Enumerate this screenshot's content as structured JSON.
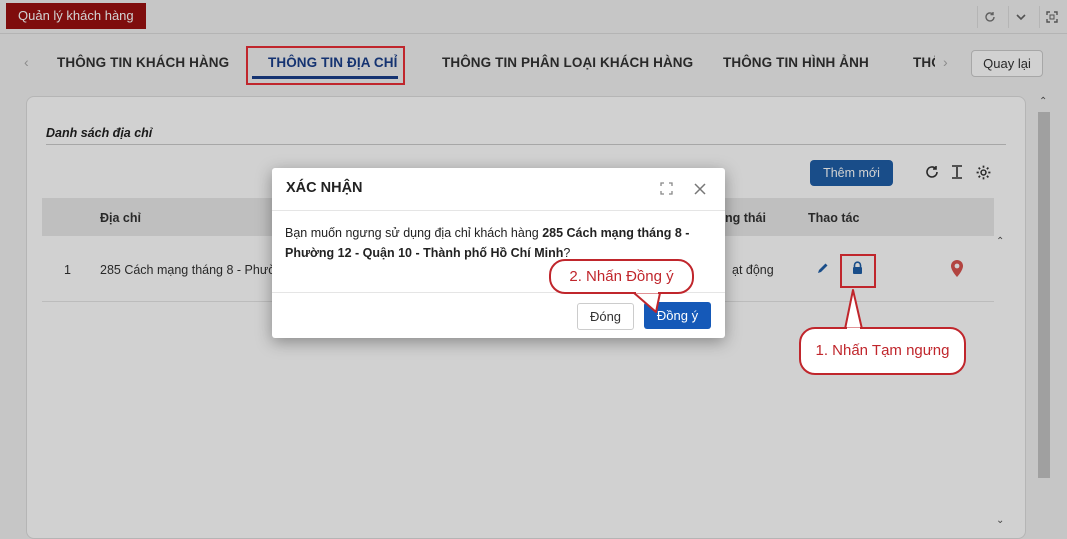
{
  "app": {
    "tab_label": "Quản lý khách hàng"
  },
  "tabs": {
    "items": [
      "THÔNG TIN KHÁCH HÀNG",
      "THÔNG TIN ĐỊA CHỈ",
      "THÔNG TIN PHÂN LOẠI KHÁCH HÀNG",
      "THÔNG TIN HÌNH ẢNH",
      "THÔ"
    ],
    "active_index": 1,
    "back_label": "Quay lại"
  },
  "section": {
    "title": "Danh sách địa chỉ",
    "add_label": "Thêm mới"
  },
  "table": {
    "headers": {
      "address": "Địa chỉ",
      "status": "ng thái",
      "actions": "Thao tác"
    },
    "rows": [
      {
        "index": "1",
        "address": "285 Cách mạng tháng 8 - Phườ",
        "status": "ạt động"
      }
    ]
  },
  "modal": {
    "title": "XÁC NHẬN",
    "message_prefix": "Bạn muốn ngưng sử dụng địa chỉ khách hàng ",
    "message_bold": "285 Cách mạng tháng 8 - Phường 12 - Quận 10 - Thành phố Hồ Chí Minh",
    "message_suffix": "?",
    "close_label": "Đóng",
    "ok_label": "Đồng ý"
  },
  "annotations": {
    "step1": "1. Nhấn Tạm ngưng",
    "step2": "2. Nhấn Đồng ý",
    "color": "#c0262c"
  },
  "colors": {
    "brand": "#9b1111",
    "primary": "#1559b8",
    "active_tab": "#1a3f8a"
  }
}
